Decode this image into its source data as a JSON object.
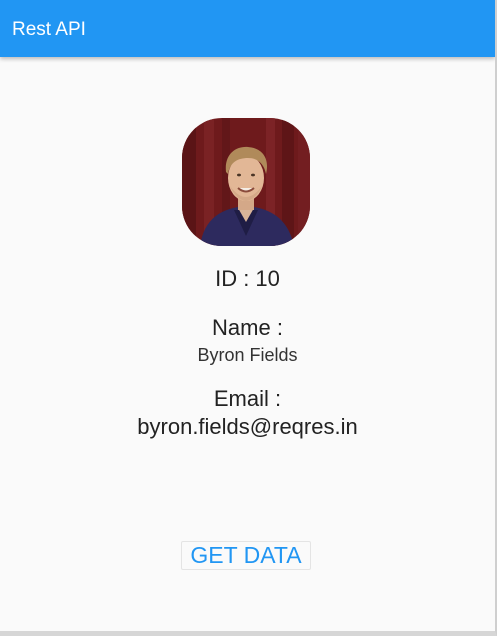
{
  "appbar": {
    "title": "Rest API",
    "color": "#2196f3"
  },
  "user": {
    "avatar_icon": "profile-photo",
    "id_text": "ID : 10",
    "name_label": "Name :",
    "name_value": "Byron Fields",
    "email_label": "Email :",
    "email_value": "byron.fields@reqres.in"
  },
  "actions": {
    "get_data_label": "GET DATA",
    "accent_color": "#2196f3"
  }
}
